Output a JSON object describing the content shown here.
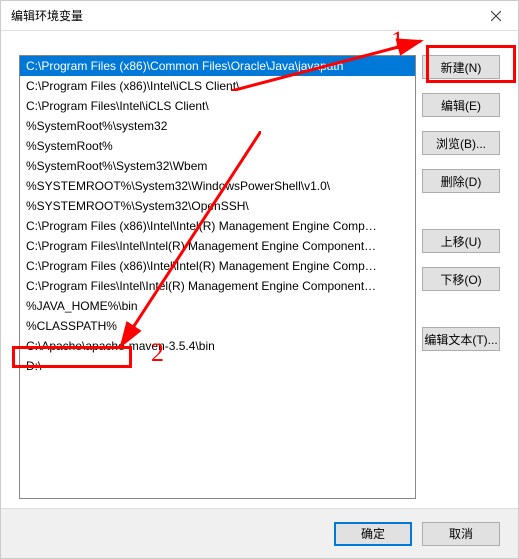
{
  "window": {
    "title": "编辑环境变量"
  },
  "list": {
    "items": [
      "C:\\Program Files (x86)\\Common Files\\Oracle\\Java\\javapath",
      "C:\\Program Files (x86)\\Intel\\iCLS Client\\",
      "C:\\Program Files\\Intel\\iCLS Client\\",
      "%SystemRoot%\\system32",
      "%SystemRoot%",
      "%SystemRoot%\\System32\\Wbem",
      "%SYSTEMROOT%\\System32\\WindowsPowerShell\\v1.0\\",
      "%SYSTEMROOT%\\System32\\OpenSSH\\",
      "C:\\Program Files (x86)\\Intel\\Intel(R) Management Engine Comp…",
      "C:\\Program Files\\Intel\\Intel(R) Management Engine Component…",
      "C:\\Program Files (x86)\\Intel\\Intel(R) Management Engine Comp…",
      "C:\\Program Files\\Intel\\Intel(R) Management Engine Component…",
      "%JAVA_HOME%\\bin",
      "%CLASSPATH%",
      "C:\\Apache\\apache-maven-3.5.4\\bin",
      "D:\\"
    ],
    "selectedIndex": 0
  },
  "buttons": {
    "new": "新建(N)",
    "edit": "编辑(E)",
    "browse": "浏览(B)...",
    "delete": "删除(D)",
    "moveUp": "上移(U)",
    "moveDown": "下移(O)",
    "editText": "编辑文本(T)..."
  },
  "bottom": {
    "ok": "确定",
    "cancel": "取消"
  },
  "annotations": {
    "label1": "1",
    "label2": "2"
  }
}
